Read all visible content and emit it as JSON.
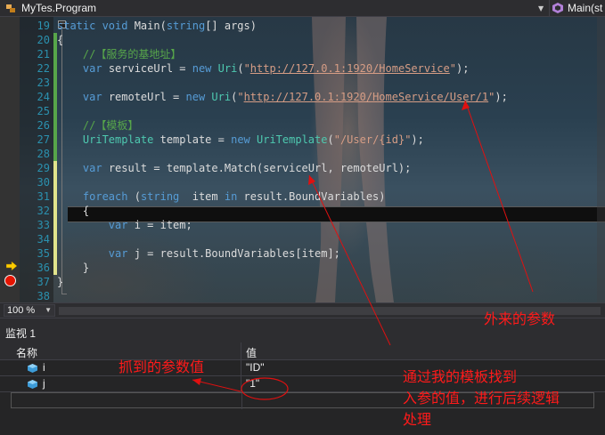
{
  "nav": {
    "left_label": "MyTes.Program",
    "right_label": "Main(st",
    "left_icon": "class-icon",
    "right_icon": "method-icon"
  },
  "editor": {
    "lines": [
      {
        "num": "19",
        "code": [
          [
            "kw",
            "static "
          ],
          [
            "kw",
            "void "
          ],
          [
            "pl",
            "Main("
          ],
          [
            "kw",
            "string"
          ],
          [
            "pl",
            "[] args)"
          ]
        ]
      },
      {
        "num": "20",
        "code": [
          [
            "pl",
            "{"
          ]
        ]
      },
      {
        "num": "21",
        "code": [
          [
            "cm",
            "    //【服务的基地址】"
          ]
        ]
      },
      {
        "num": "22",
        "code": [
          [
            "pl",
            "    "
          ],
          [
            "kw",
            "var "
          ],
          [
            "pl",
            "serviceUrl = "
          ],
          [
            "kw",
            "new "
          ],
          [
            "ty",
            "Uri"
          ],
          [
            "pl",
            "("
          ],
          [
            "st",
            "\""
          ],
          [
            "url",
            "http://127.0.1:1920/HomeService"
          ],
          [
            "st",
            "\""
          ],
          [
            "pl",
            ");"
          ]
        ]
      },
      {
        "num": "23",
        "code": []
      },
      {
        "num": "24",
        "code": [
          [
            "pl",
            "    "
          ],
          [
            "kw",
            "var "
          ],
          [
            "pl",
            "remoteUrl = "
          ],
          [
            "kw",
            "new "
          ],
          [
            "ty",
            "Uri"
          ],
          [
            "pl",
            "("
          ],
          [
            "st",
            "\""
          ],
          [
            "url",
            "http://127.0.1:1920/HomeService/User/1"
          ],
          [
            "st",
            "\""
          ],
          [
            "pl",
            ");"
          ]
        ]
      },
      {
        "num": "25",
        "code": []
      },
      {
        "num": "26",
        "code": [
          [
            "cm",
            "    //【模板】"
          ]
        ]
      },
      {
        "num": "27",
        "code": [
          [
            "pl",
            "    "
          ],
          [
            "ty",
            "UriTemplate "
          ],
          [
            "pl",
            "template = "
          ],
          [
            "kw",
            "new "
          ],
          [
            "ty",
            "UriTemplate"
          ],
          [
            "pl",
            "("
          ],
          [
            "st",
            "\"/User/{id}\""
          ],
          [
            "pl",
            ");"
          ]
        ]
      },
      {
        "num": "28",
        "code": []
      },
      {
        "num": "29",
        "code": [
          [
            "pl",
            "    "
          ],
          [
            "kw",
            "var "
          ],
          [
            "pl",
            "result = template.Match(serviceUrl, remoteUrl);"
          ]
        ]
      },
      {
        "num": "30",
        "code": []
      },
      {
        "num": "31",
        "code": [
          [
            "pl",
            "    "
          ],
          [
            "kw",
            "foreach "
          ],
          [
            "pl",
            "("
          ],
          [
            "kw",
            "string  "
          ],
          [
            "pl",
            "item "
          ],
          [
            "kw",
            "in "
          ],
          [
            "pl",
            "result.BoundVariables)"
          ]
        ]
      },
      {
        "num": "32",
        "code": [
          [
            "pl",
            "    {"
          ]
        ]
      },
      {
        "num": "33",
        "code": [
          [
            "pl",
            "        "
          ],
          [
            "kw",
            "var "
          ],
          [
            "pl",
            "i = item;"
          ]
        ]
      },
      {
        "num": "34",
        "code": []
      },
      {
        "num": "35",
        "code": [
          [
            "pl",
            "        "
          ],
          [
            "kw",
            "var "
          ],
          [
            "pl",
            "j = result.BoundVariables[item];"
          ]
        ]
      },
      {
        "num": "36",
        "code": [
          [
            "pl",
            "    }"
          ]
        ]
      },
      {
        "num": "37",
        "code": [
          [
            "pl",
            "}"
          ]
        ]
      },
      {
        "num": "38",
        "code": []
      }
    ]
  },
  "zoom": {
    "value": "100 %"
  },
  "watch": {
    "title": "监视 1",
    "col_name": "名称",
    "col_value": "值",
    "rows": [
      {
        "name": "i",
        "value": "\"ID\""
      },
      {
        "name": "j",
        "value": "\"1\""
      }
    ]
  },
  "annotations": {
    "external_params": "外来的参数",
    "captured_value": "抓到的参数值",
    "explain_line1": "通过我的模板找到",
    "explain_line2": "入参的值，进行后续逻辑",
    "explain_line3": "处理"
  },
  "colors": {
    "keyword": "#569cd6",
    "type": "#4ec9b0",
    "string": "#d69d85",
    "comment": "#57a64a",
    "line_number": "#2b91af",
    "annotation": "#ff1a1a",
    "breakpoint": "#e51400"
  }
}
